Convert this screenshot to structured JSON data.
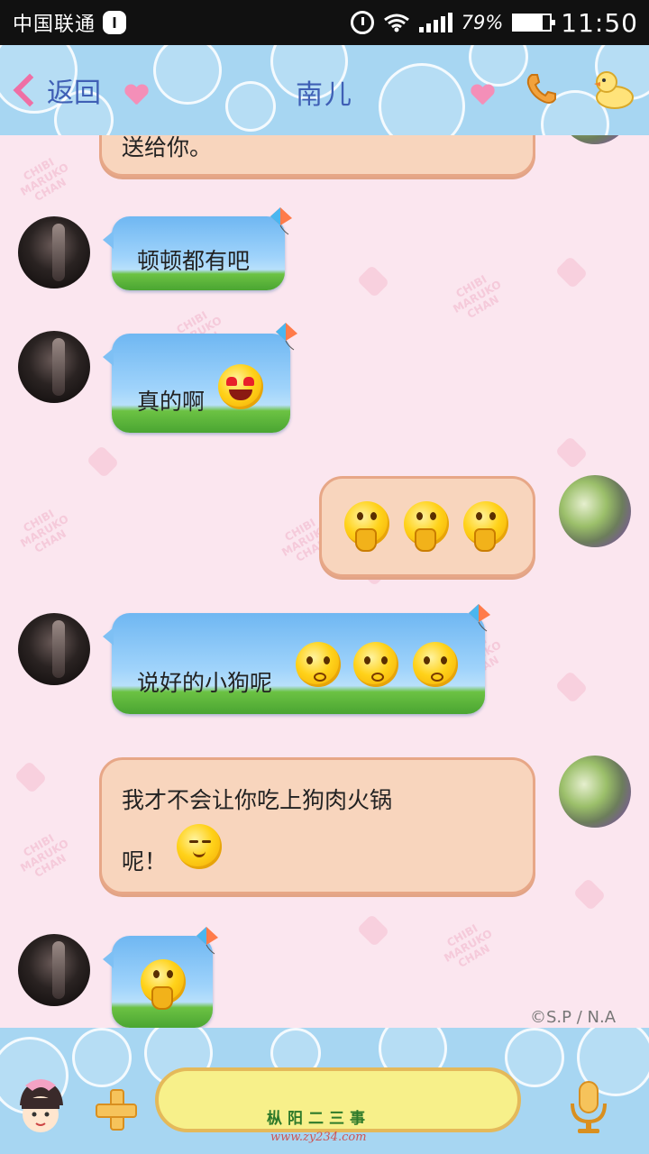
{
  "status_bar": {
    "carrier": "中国联通",
    "notification_badge": "l",
    "battery_percent_text": "79%",
    "battery_level": 0.79,
    "time": "11:50"
  },
  "header": {
    "back_label": "返回",
    "title": "南儿"
  },
  "messages": {
    "m0": {
      "side": "right",
      "text": "送给你。"
    },
    "m1": {
      "side": "left",
      "text": "顿顿都有吧"
    },
    "m2": {
      "side": "left",
      "text": "真的啊",
      "emoji": [
        "heart-eyes-emoji"
      ]
    },
    "m3": {
      "side": "right",
      "emoji": [
        "thinking-emoji",
        "thinking-emoji",
        "thinking-emoji"
      ]
    },
    "m4": {
      "side": "left",
      "text": "说好的小狗呢",
      "emoji": [
        "frown-emoji",
        "frown-emoji",
        "frown-emoji"
      ]
    },
    "m5": {
      "side": "right",
      "text_line1": "我才不会让你吃上狗肉火锅",
      "text_line2": "呢！",
      "emoji": [
        "smug-emoji"
      ]
    },
    "m6": {
      "side": "left",
      "emoji": [
        "thinking-emoji"
      ]
    }
  },
  "copyright": "©S.P / N.A",
  "input_bar": {
    "watermark_text": "枞阳二三事",
    "watermark_url": "www.zy234.com"
  },
  "colors": {
    "header_blue": "#a7d6f2",
    "title_blue": "#3f5fb5",
    "accent_pink": "#ef6fa5",
    "pig_bubble": "#f8d5bd",
    "blue_bubble": "#9fd3fb"
  }
}
